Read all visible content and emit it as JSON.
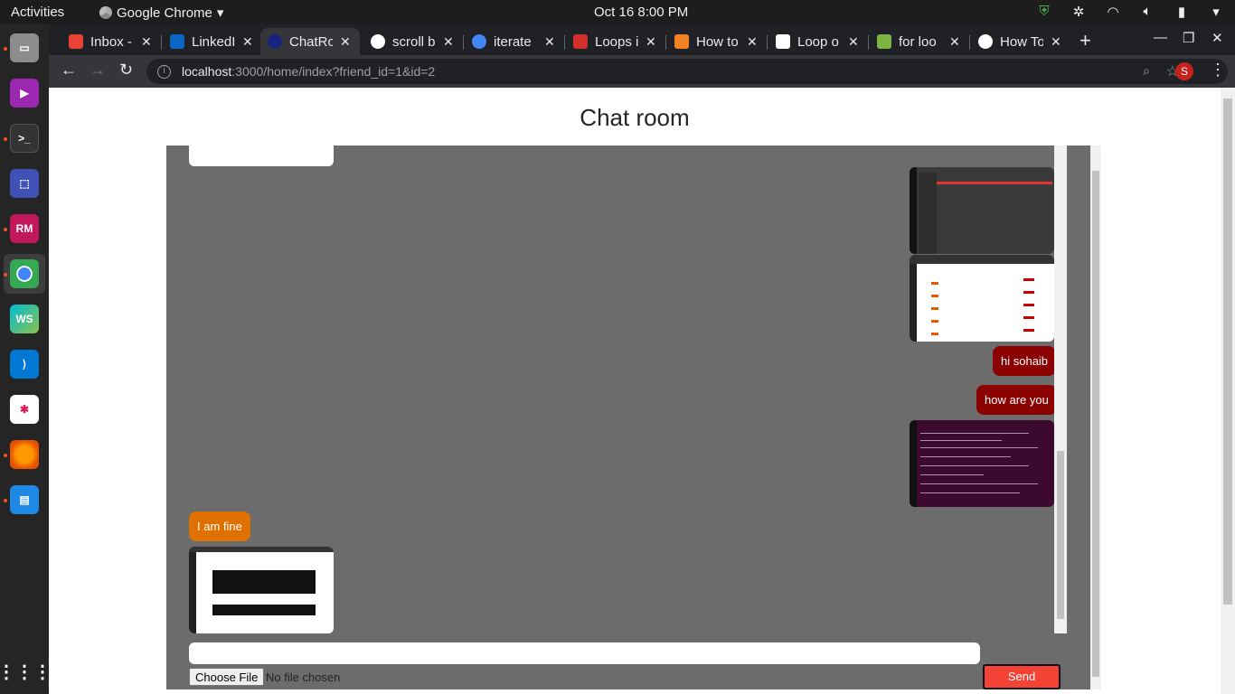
{
  "topbar": {
    "activities": "Activities",
    "app_name": "Google Chrome",
    "clock": "Oct 16   8:00 PM"
  },
  "dock": {
    "icons": [
      "files-icon",
      "video-player-icon",
      "terminal-icon",
      "screenshot-icon",
      "rubymine-icon",
      "chrome-icon",
      "webstorm-icon",
      "vscode-icon",
      "slack-icon",
      "firefox-icon",
      "libreoffice-writer-icon",
      "show-apps-icon"
    ]
  },
  "tabs": [
    {
      "title": "Inbox - ",
      "favicon_color": "#ea4335"
    },
    {
      "title": "LinkedI",
      "favicon_color": "#0a66c2"
    },
    {
      "title": "ChatRo",
      "favicon_color": "#1a237e"
    },
    {
      "title": "scroll b",
      "favicon_color": "#ffffff"
    },
    {
      "title": "iterate",
      "favicon_color": "#4285f4"
    },
    {
      "title": "Loops i",
      "favicon_color": "#d32f2f"
    },
    {
      "title": "How to",
      "favicon_color": "#f48024"
    },
    {
      "title": "Loop o",
      "favicon_color": "#ffffff"
    },
    {
      "title": "for loo",
      "favicon_color": "#7cb342"
    },
    {
      "title": "How To",
      "favicon_color": "#ffffff"
    }
  ],
  "address_bar": {
    "host": "localhost",
    "path": ":3000/home/index?friend_id=1&id=2",
    "profile_initial": "S"
  },
  "page": {
    "title": "Chat room"
  },
  "messages": [
    {
      "from": "me",
      "text": "hi sohaib"
    },
    {
      "from": "me",
      "text": "how are you"
    },
    {
      "from": "friend",
      "text": "I am fine"
    }
  ],
  "composer": {
    "input_value": "",
    "file_button": "Choose File",
    "file_status": "No file chosen",
    "send_label": "Send"
  }
}
